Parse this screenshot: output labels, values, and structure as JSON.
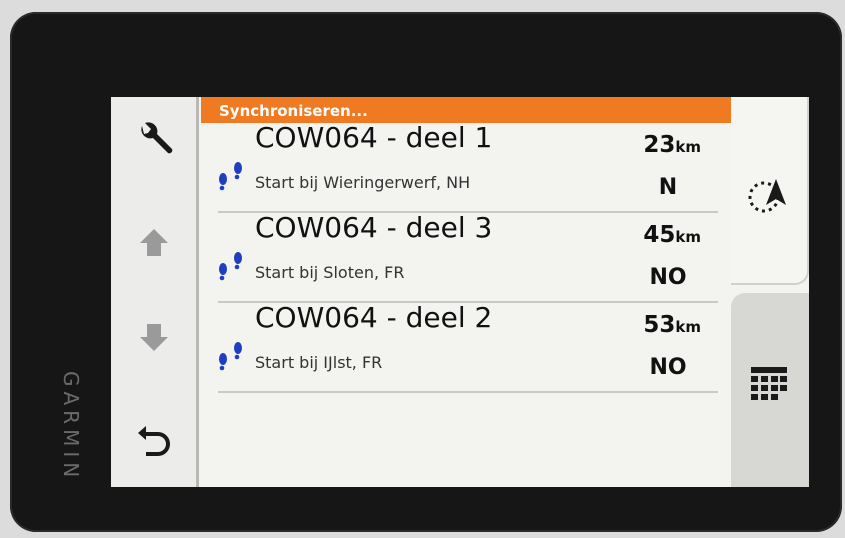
{
  "device": {
    "brand": "GARMIN"
  },
  "status": {
    "sync_text": "Synchroniseren..."
  },
  "left_toolbar": {
    "items": [
      {
        "icon": "wrench-icon"
      },
      {
        "icon": "arrow-up-icon"
      },
      {
        "icon": "arrow-down-icon"
      },
      {
        "icon": "back-icon"
      }
    ]
  },
  "routes": [
    {
      "icon": "footprints-icon",
      "title": "COW064 - deel 1",
      "subtitle": "Start bij Wieringerwerf, NH",
      "distance": "23",
      "unit": "km",
      "direction": "N"
    },
    {
      "icon": "footprints-icon",
      "title": "COW064 - deel 3",
      "subtitle": "Start bij Sloten, FR",
      "distance": "45",
      "unit": "km",
      "direction": "NO"
    },
    {
      "icon": "footprints-icon",
      "title": "COW064 - deel 2",
      "subtitle": "Start bij IJlst, FR",
      "distance": "53",
      "unit": "km",
      "direction": "NO"
    }
  ],
  "right_toolbar": {
    "items": [
      {
        "icon": "navigate-circle-arrow-icon"
      },
      {
        "icon": "calendar-grid-icon"
      }
    ]
  },
  "colors": {
    "sync_bar": "#f07a22",
    "route_icon": "#1f3fbf",
    "screen_bg": "#f3f3f0"
  }
}
